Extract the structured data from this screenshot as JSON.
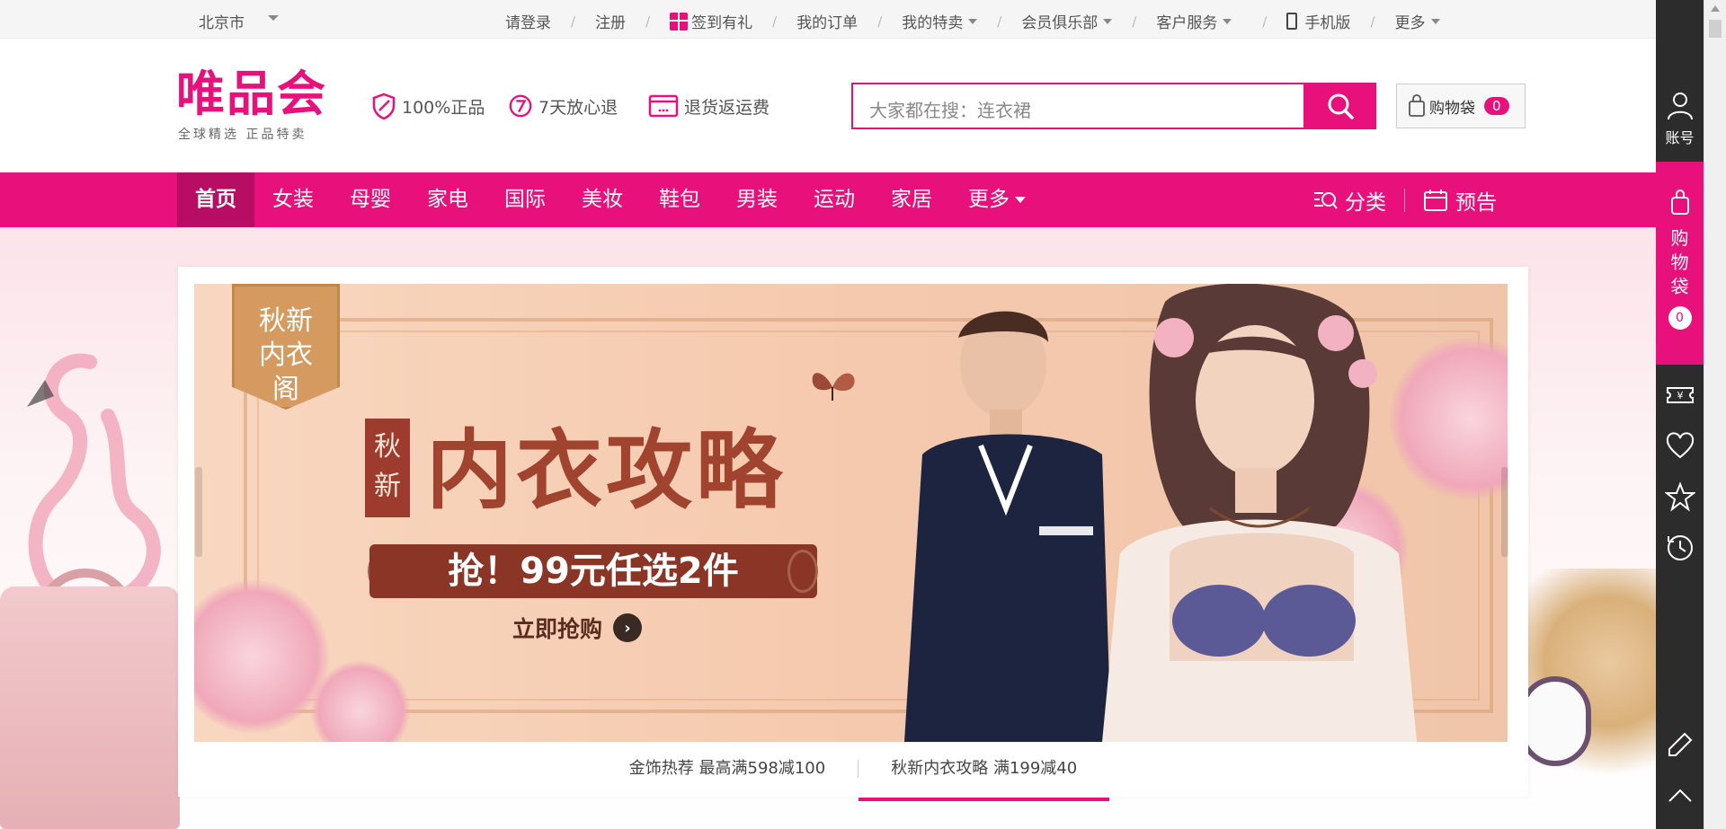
{
  "topbar": {
    "city": "北京市",
    "links": [
      {
        "label": "请登录"
      },
      {
        "label": "注册"
      },
      {
        "label": "签到有礼"
      },
      {
        "label": "我的订单"
      },
      {
        "label": "我的特卖"
      },
      {
        "label": "会员俱乐部"
      },
      {
        "label": "客户服务"
      },
      {
        "label": "手机版"
      },
      {
        "label": "更多"
      }
    ]
  },
  "header": {
    "logo": "唯品会",
    "logo_sub": "全球精选  正品特卖",
    "promises": [
      "100%正品",
      "7天放心退",
      "退货返运费"
    ],
    "search_placeholder": "大家都在搜：连衣裙",
    "cart_label": "购物袋",
    "cart_count": "0"
  },
  "nav": {
    "items": [
      "首页",
      "女装",
      "母婴",
      "家电",
      "国际",
      "美妆",
      "鞋包",
      "男装",
      "运动",
      "家居",
      "更多"
    ],
    "category": "分类",
    "preview": "预告"
  },
  "banner": {
    "badge": "秋新内衣阁",
    "seal": "秋新",
    "headline": "内衣攻略",
    "offer": "抢！99元任选2件",
    "cta": "立即抢购"
  },
  "tabs": [
    "金饰热荐 最高满598减100",
    "秋新内衣攻略 满199减40"
  ],
  "sidebar": {
    "account": "账号",
    "cart": "购物袋",
    "cart_count": "0"
  },
  "colors": {
    "brand": "#e8107a",
    "nav_active": "#b70d62",
    "sidebar": "#2c2c2c"
  }
}
